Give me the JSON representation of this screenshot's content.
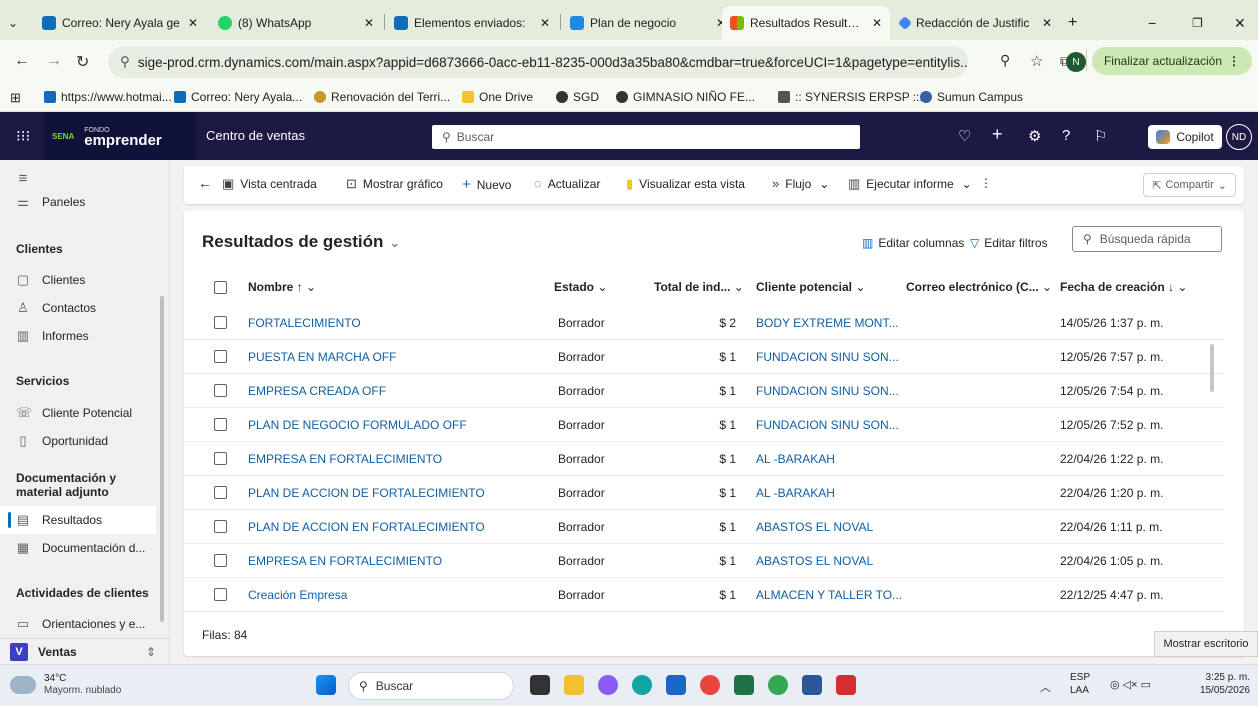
{
  "tabs": [
    {
      "label": "Correo: Nery Ayala ge",
      "color": "#0f6cbd"
    },
    {
      "label": "(8) WhatsApp",
      "color": "#25d366"
    },
    {
      "label": "Elementos enviados: ",
      "color": "#0f6cbd"
    },
    {
      "label": "Plan de negocio",
      "color": "#1e88e5"
    },
    {
      "label": "Resultados Resultado",
      "color": "#f25022"
    },
    {
      "label": "Redacción de Justific",
      "color": "#4285f4"
    }
  ],
  "address": {
    "url": "sige-prod.crm.dynamics.com/main.aspx?appid=d6873666-0acc-eb11-8235-000d3a35ba80&cmdbar=true&forceUCI=1&pagetype=entitylis...",
    "profile": "N",
    "update_label": "Finalizar actualización"
  },
  "bookmarks": [
    "https://www.hotmai...",
    "Correo: Nery Ayala...",
    "Renovación del Terri...",
    "One Drive",
    "SGD",
    "GIMNASIO NIÑO FE...",
    ":: SYNERSIS ERPSP ::...",
    "Sumun Campus"
  ],
  "header": {
    "logo": "emprender",
    "logo_small": "FONDO",
    "sena": "SENA",
    "app_name": "Centro de ventas",
    "search_placeholder": "Buscar",
    "copilot": "Copilot",
    "avatar": "ND"
  },
  "sidebar": {
    "panels": "Paneles",
    "groups": [
      {
        "title": "Clientes",
        "items": [
          "Clientes",
          "Contactos",
          "Informes"
        ]
      },
      {
        "title": "Servicios",
        "items": [
          "Cliente Potencial",
          "Oportunidad"
        ]
      },
      {
        "title": "Documentación y material adjunto",
        "items": [
          "Resultados",
          "Documentación d..."
        ]
      },
      {
        "title": "Actividades de clientes",
        "items": [
          "Orientaciones y e..."
        ]
      }
    ],
    "area": "Ventas",
    "area_letter": "V"
  },
  "commands": {
    "centered": "Vista centrada",
    "chart": "Mostrar gráfico",
    "new": "Nuevo",
    "refresh": "Actualizar",
    "visualize": "Visualizar esta vista",
    "flow": "Flujo",
    "report": "Ejecutar informe",
    "share": "Compartir"
  },
  "grid": {
    "title": "Resultados de gestión",
    "edit_columns": "Editar columnas",
    "edit_filters": "Editar filtros",
    "quick_search": "Búsqueda rápida",
    "columns": [
      "Nombre ↑",
      "Estado",
      "Total de ind...",
      "Cliente potencial",
      "Correo electrónico (C...",
      "Fecha de creación ↓"
    ],
    "rows": [
      {
        "name": "FORTALECIMIENTO",
        "estado": "Borrador",
        "total": "$ 2",
        "cliente": "BODY EXTREME MONT...",
        "fecha": "14/05/26 1:37 p. m."
      },
      {
        "name": "PUESTA EN MARCHA OFF",
        "estado": "Borrador",
        "total": "$ 1",
        "cliente": "FUNDACION SINU SON...",
        "fecha": "12/05/26 7:57 p. m."
      },
      {
        "name": "EMPRESA  CREADA OFF",
        "estado": "Borrador",
        "total": "$ 1",
        "cliente": "FUNDACION SINU SON...",
        "fecha": "12/05/26 7:54 p. m."
      },
      {
        "name": "PLAN DE NEGOCIO FORMULADO OFF",
        "estado": "Borrador",
        "total": "$ 1",
        "cliente": "FUNDACION SINU SON...",
        "fecha": "12/05/26 7:52 p. m."
      },
      {
        "name": "EMPRESA EN FORTALECIMIENTO",
        "estado": "Borrador",
        "total": "$ 1",
        "cliente": "AL -BARAKAH",
        "fecha": "22/04/26 1:22 p. m."
      },
      {
        "name": "PLAN DE ACCION DE FORTALECIMIENTO",
        "estado": "Borrador",
        "total": "$ 1",
        "cliente": "AL -BARAKAH",
        "fecha": "22/04/26 1:20 p. m."
      },
      {
        "name": "PLAN DE ACCION EN FORTALECIMIENTO",
        "estado": "Borrador",
        "total": "$ 1",
        "cliente": "ABASTOS EL NOVAL",
        "fecha": "22/04/26 1:11 p. m."
      },
      {
        "name": "EMPRESA EN FORTALECIMIENTO",
        "estado": "Borrador",
        "total": "$ 1",
        "cliente": "ABASTOS EL NOVAL",
        "fecha": "22/04/26 1:05 p. m."
      },
      {
        "name": "Creación Empresa",
        "estado": "Borrador",
        "total": "$ 1",
        "cliente": "ALMACEN Y TALLER TO...",
        "fecha": "22/12/25 4:47 p. m."
      }
    ],
    "row_count": "Filas: 84"
  },
  "tooltip": "Mostrar escritorio",
  "taskbar": {
    "temp": "34°C",
    "weather": "Mayorm. nublado",
    "search": "Buscar",
    "lang1": "ESP",
    "lang2": "LAA",
    "time": "3:25 p. m.",
    "date": "15/05/2026"
  }
}
